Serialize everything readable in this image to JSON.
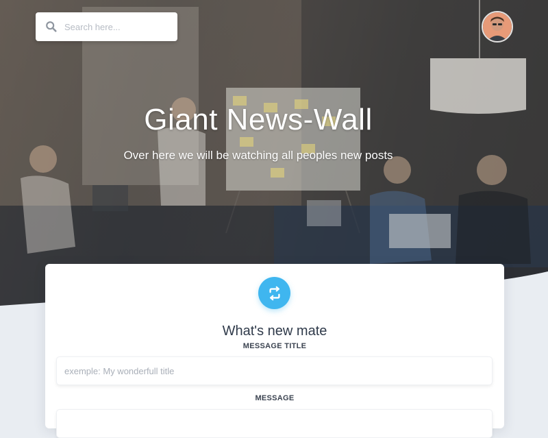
{
  "search": {
    "placeholder": "Search here..."
  },
  "user": {
    "avatar_alt": "User avatar"
  },
  "hero": {
    "title": "Giant News-Wall",
    "subtitle": "Over here we will be watching all peoples new posts"
  },
  "post_form": {
    "icon": "repost-icon",
    "heading": "What's new mate",
    "title_label": "MESSAGE TITLE",
    "title_placeholder": "exemple: My wonderfull title",
    "message_label": "MESSAGE",
    "message_placeholder": ""
  },
  "colors": {
    "accent": "#3fb6ef",
    "page_background": "#e9edf2",
    "card_background": "#ffffff",
    "heading_text": "#2f3a4a"
  }
}
